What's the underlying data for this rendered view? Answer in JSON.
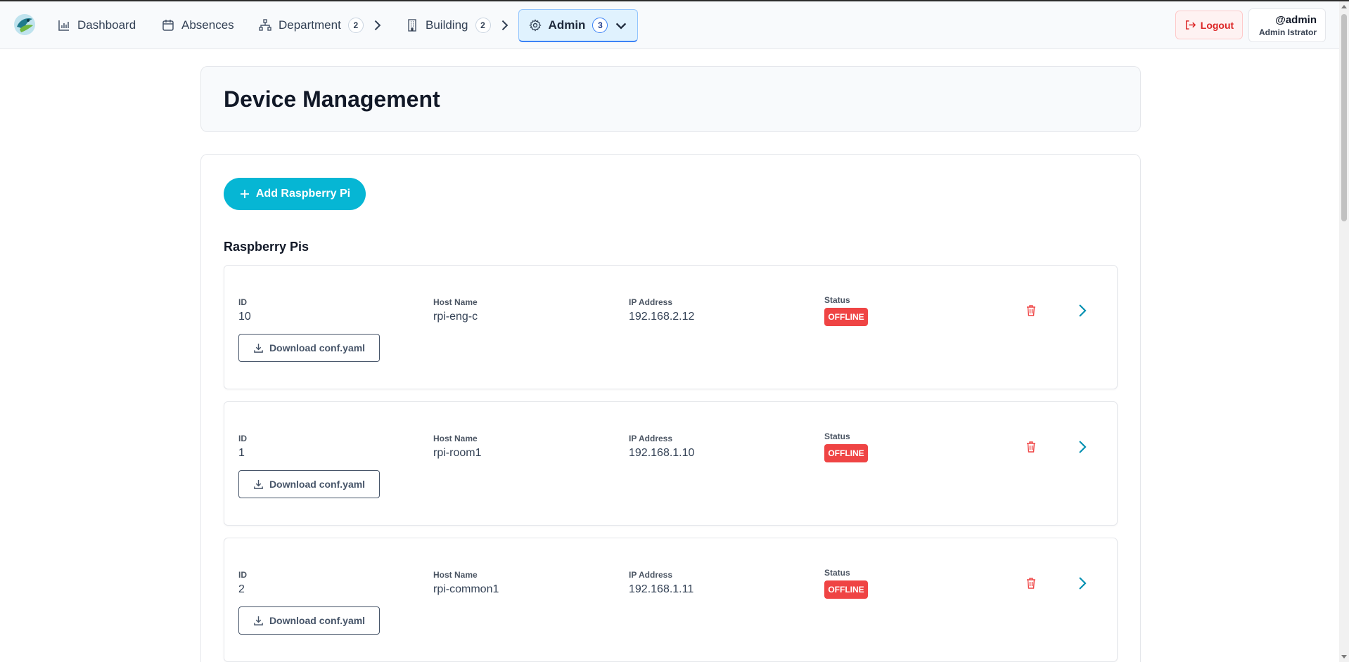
{
  "nav": {
    "items": [
      {
        "label": "Dashboard"
      },
      {
        "label": "Absences"
      },
      {
        "label": "Department",
        "count": "2"
      },
      {
        "label": "Building",
        "count": "2"
      },
      {
        "label": "Admin",
        "count": "3"
      }
    ],
    "logout_label": "Logout",
    "user_handle": "@admin",
    "user_name": "Admin Istrator"
  },
  "page": {
    "title": "Device Management",
    "add_button_label": "Add Raspberry Pi",
    "section_title": "Raspberry Pis"
  },
  "labels": {
    "id": "ID",
    "host": "Host Name",
    "ip": "IP Address",
    "status": "Status",
    "download": "Download conf.yaml"
  },
  "devices": [
    {
      "id": "10",
      "host": "rpi-eng-c",
      "ip": "192.168.2.12",
      "status": "OFFLINE"
    },
    {
      "id": "1",
      "host": "rpi-room1",
      "ip": "192.168.1.10",
      "status": "OFFLINE"
    },
    {
      "id": "2",
      "host": "rpi-common1",
      "ip": "192.168.1.11",
      "status": "OFFLINE"
    }
  ],
  "colors": {
    "accent": "#06b6d4",
    "offline": "#ef4444",
    "danger": "#dc2626"
  }
}
